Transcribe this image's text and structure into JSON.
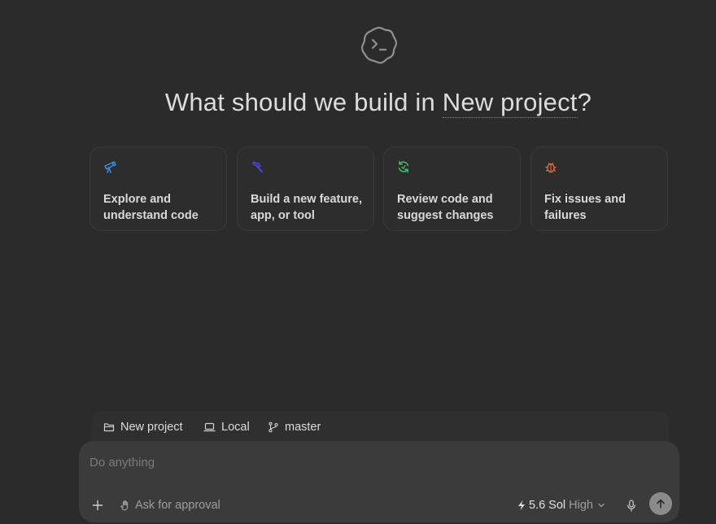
{
  "headline": {
    "prefix": "What should we build in",
    "project": "New project",
    "suffix": "?"
  },
  "cards": [
    {
      "label": "Explore and understand code",
      "icon": "telescope-icon",
      "color": "#3b8fe0"
    },
    {
      "label": "Build a new feature, app, or tool",
      "icon": "hammer-icon",
      "color": "#4b4bc8"
    },
    {
      "label": "Review code and suggest changes",
      "icon": "refresh-icon",
      "color": "#3fbf6a"
    },
    {
      "label": "Fix issues and failures",
      "icon": "bug-icon",
      "color": "#e0683a"
    }
  ],
  "context": {
    "project": "New project",
    "environment": "Local",
    "branch": "master"
  },
  "composer": {
    "placeholder": "Do anything",
    "approval": "Ask for approval",
    "model": "5.6 Sol",
    "reasoning": "High"
  },
  "colors": {
    "background": "#2b2b2b",
    "composer": "#3b3b3b",
    "send_button": "#8b8b8b"
  }
}
